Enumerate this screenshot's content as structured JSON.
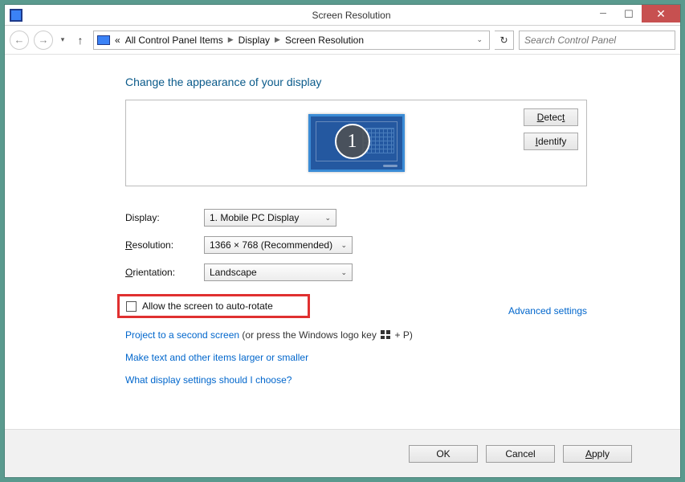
{
  "titlebar": {
    "title": "Screen Resolution"
  },
  "breadcrumb": {
    "prefix": "«",
    "items": [
      "All Control Panel Items",
      "Display",
      "Screen Resolution"
    ]
  },
  "search": {
    "placeholder": "Search Control Panel"
  },
  "page": {
    "title": "Change the appearance of your display",
    "monitor_number": "1",
    "detect": "Detect",
    "identify": "Identify"
  },
  "form": {
    "display_label": "Display:",
    "display_value": "1. Mobile PC Display",
    "resolution_label": "Resolution:",
    "resolution_value": "1366 × 768 (Recommended)",
    "orientation_label": "Orientation:",
    "orientation_value": "Landscape",
    "autorotate_label": "Allow the screen to auto-rotate",
    "advanced": "Advanced settings"
  },
  "links": {
    "project_link": "Project to a second screen",
    "project_rest": " (or press the Windows logo key ",
    "project_tail": " + P)",
    "make_text": "Make text and other items larger or smaller",
    "what_display": "What display settings should I choose?"
  },
  "buttons": {
    "ok": "OK",
    "cancel": "Cancel",
    "apply": "Apply"
  }
}
